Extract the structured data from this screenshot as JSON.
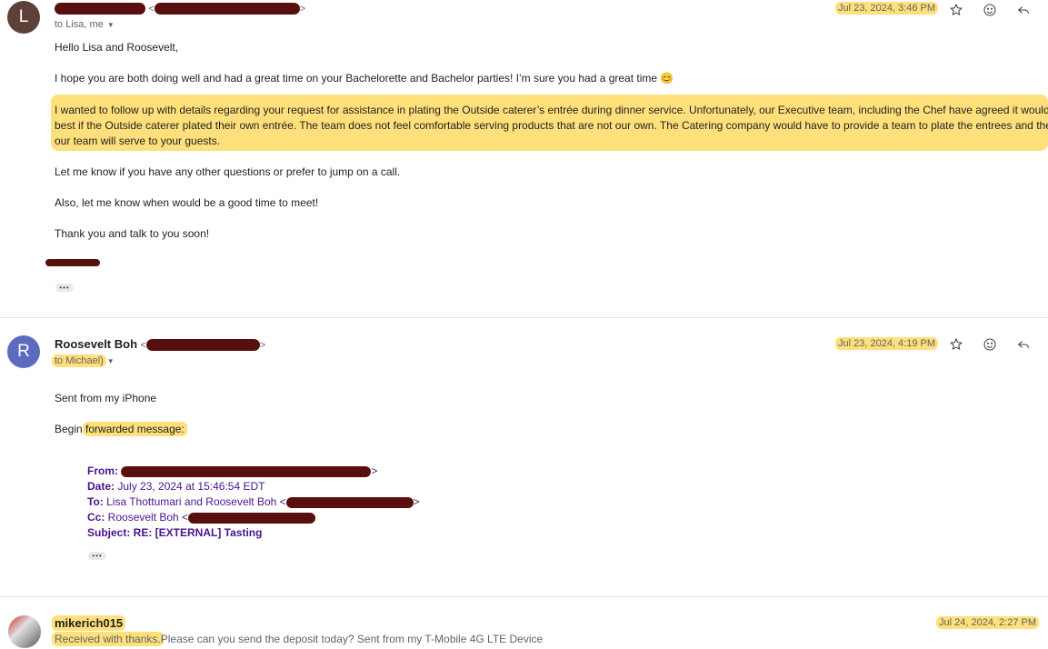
{
  "messages": [
    {
      "avatar_letter": "L",
      "avatar_color": "#5d4037",
      "sender_email_open": "<",
      "sender_email_close": ">",
      "to_line": "to Lisa, me",
      "date": "Jul 23, 2024, 3:46 PM",
      "greeting": "Hello Lisa and Roosevelt,",
      "para1": "I hope you are both doing well and had a great time on your Bachelorette and Bachelor parties!  I’m sure you had a great time 😊",
      "para2_line1": "I wanted to follow up with details regarding your request for assistance in plating the Outside caterer’s entrée during dinner service. Unfortunately, our Executive team, including the Chef have agreed it would b",
      "para2_line2": "best if the Outside caterer plated their own entrée. The team does not feel comfortable serving products that are not our own.  The Catering company would have to provide a team to plate the entrees and the",
      "para2_line3": "our team will serve to your guests.",
      "para3": "Let me know if you have any other questions or prefer to jump on a call.",
      "para4": "Also, let me know when would be a good time to meet!",
      "para5": "Thank you and talk to you soon!"
    },
    {
      "avatar_letter": "R",
      "avatar_color": "#5c6bc0",
      "sender_name": "Roosevelt Boh",
      "sender_email_open": "<",
      "sender_email_close": ">",
      "to_line": "to Michael)",
      "date": "Jul 23, 2024, 4:19 PM",
      "line1": "Sent from my iPhone",
      "line2_prefix": "Begin ",
      "line2_highlight": "forwarded message:",
      "forward": {
        "from_label": "From:",
        "from_tail": ">",
        "date_label": "Date:",
        "date_value": " July 23, 2024 at 15:46:54 EDT",
        "to_label": "To:",
        "to_value": " Lisa Thottumari and Roosevelt Boh <",
        "to_tail": ">",
        "cc_label": "Cc:",
        "cc_value": " Roosevelt Boh <",
        "subject_label": "Subject:",
        "subject_value": " RE: [EXTERNAL] Tasting"
      }
    },
    {
      "sender_name": "mikerich015",
      "date": "Jul 24, 2024, 2:27 PM",
      "snippet_highlight": "Received with thanks.",
      "snippet_rest": "Please can you send the deposit today? Sent from my T-Mobile 4G LTE Device"
    }
  ],
  "icons": [
    "star-icon",
    "emoji-icon",
    "reply-icon",
    "chevron-down-icon"
  ],
  "ellipsis_label": "•••"
}
